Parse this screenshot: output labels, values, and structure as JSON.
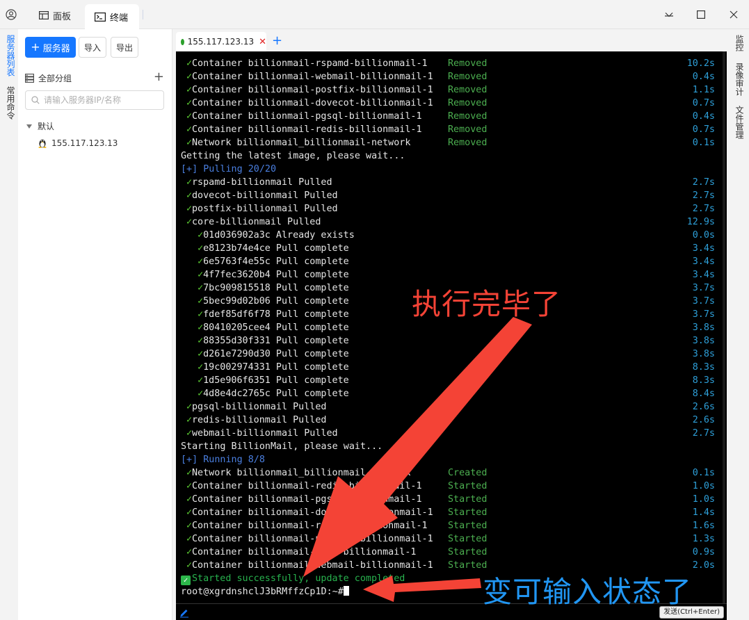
{
  "titlebar": {
    "tabs": [
      {
        "label": "面板",
        "icon": "dashboard-icon"
      },
      {
        "label": "终端",
        "icon": "terminal-icon"
      }
    ]
  },
  "left_rail": {
    "items": [
      {
        "label": "服务器列表",
        "active": true
      },
      {
        "label": "常用命令",
        "active": false
      }
    ]
  },
  "server_panel": {
    "add_label": "服务器",
    "import_label": "导入",
    "export_label": "导出",
    "group_label": "全部分组",
    "search_placeholder": "请输入服务器IP/名称",
    "default_group": "默认",
    "server_ip": "155.117.123.13"
  },
  "terminal_tab": {
    "label": "155.117.123.13"
  },
  "terminal": {
    "lines": [
      {
        "check": true,
        "text": "Container billionmail-rspamd-billionmail-1",
        "status": "Removed",
        "time": "10.2s"
      },
      {
        "check": true,
        "text": "Container billionmail-webmail-billionmail-1",
        "status": "Removed",
        "time": "0.4s"
      },
      {
        "check": true,
        "text": "Container billionmail-postfix-billionmail-1",
        "status": "Removed",
        "time": "1.1s"
      },
      {
        "check": true,
        "text": "Container billionmail-dovecot-billionmail-1",
        "status": "Removed",
        "time": "0.7s"
      },
      {
        "check": true,
        "text": "Container billionmail-pgsql-billionmail-1",
        "status": "Removed",
        "time": "0.4s"
      },
      {
        "check": true,
        "text": "Container billionmail-redis-billionmail-1",
        "status": "Removed",
        "time": "0.7s"
      },
      {
        "check": true,
        "text": "Network billionmail_billionmail-network",
        "status": "Removed",
        "time": "0.1s"
      },
      {
        "check": false,
        "text": "Getting the latest image, please wait..."
      },
      {
        "check": false,
        "text": "[+] Pulling 20/20",
        "header": true
      },
      {
        "check": true,
        "text": "rspamd-billionmail Pulled",
        "time": "2.7s"
      },
      {
        "check": true,
        "text": "dovecot-billionmail Pulled",
        "time": "2.7s"
      },
      {
        "check": true,
        "text": "postfix-billionmail Pulled",
        "time": "2.7s"
      },
      {
        "check": true,
        "text": "core-billionmail Pulled",
        "time": "12.9s"
      },
      {
        "check": true,
        "indent": true,
        "text": "01d036902a3c Already exists",
        "time": "0.0s"
      },
      {
        "check": true,
        "indent": true,
        "text": "e8123b74e4ce Pull complete",
        "time": "3.4s"
      },
      {
        "check": true,
        "indent": true,
        "text": "6e5763f4e55c Pull complete",
        "time": "3.4s"
      },
      {
        "check": true,
        "indent": true,
        "text": "4f7fec3620b4 Pull complete",
        "time": "3.4s"
      },
      {
        "check": true,
        "indent": true,
        "text": "7bc909815518 Pull complete",
        "time": "3.7s"
      },
      {
        "check": true,
        "indent": true,
        "text": "5bec99d02b06 Pull complete",
        "time": "3.7s"
      },
      {
        "check": true,
        "indent": true,
        "text": "fdef85df6f78 Pull complete",
        "time": "3.7s"
      },
      {
        "check": true,
        "indent": true,
        "text": "80410205cee4 Pull complete",
        "time": "3.8s"
      },
      {
        "check": true,
        "indent": true,
        "text": "88355d30f331 Pull complete",
        "time": "3.8s"
      },
      {
        "check": true,
        "indent": true,
        "text": "d261e7290d30 Pull complete",
        "time": "3.8s"
      },
      {
        "check": true,
        "indent": true,
        "text": "19c002974331 Pull complete",
        "time": "8.3s"
      },
      {
        "check": true,
        "indent": true,
        "text": "1d5e906f6351 Pull complete",
        "time": "8.3s"
      },
      {
        "check": true,
        "indent": true,
        "text": "4d8e4dc2765c Pull complete",
        "time": "8.4s"
      },
      {
        "check": true,
        "text": "pgsql-billionmail Pulled",
        "time": "2.6s"
      },
      {
        "check": true,
        "text": "redis-billionmail Pulled",
        "time": "2.6s"
      },
      {
        "check": true,
        "text": "webmail-billionmail Pulled",
        "time": "2.7s"
      },
      {
        "check": false,
        "text": "Starting BillionMail, please wait..."
      },
      {
        "check": false,
        "text": "[+] Running 8/8",
        "header": true
      },
      {
        "check": true,
        "text": "Network billionmail_billionmail-network",
        "status": "Created",
        "time": "0.1s"
      },
      {
        "check": true,
        "text": "Container billionmail-redis-billionmail-1",
        "status": "Started",
        "time": "1.0s"
      },
      {
        "check": true,
        "text": "Container billionmail-pgsql-billionmail-1",
        "status": "Started",
        "time": "1.0s"
      },
      {
        "check": true,
        "text": "Container billionmail-dovecot-billionmail-1",
        "status": "Started",
        "time": "1.4s"
      },
      {
        "check": true,
        "text": "Container billionmail-rspamd-billionmail-1",
        "status": "Started",
        "time": "1.6s"
      },
      {
        "check": true,
        "text": "Container billionmail-postfix-billionmail-1",
        "status": "Started",
        "time": "1.3s"
      },
      {
        "check": true,
        "text": "Container billionmail-core-billionmail-1",
        "status": "Started",
        "time": "0.9s"
      },
      {
        "check": true,
        "text": "Container billionmail-webmail-billionmail-1",
        "status": "Started",
        "time": "2.0s"
      },
      {
        "check": false,
        "success_box": true,
        "text": "Started successfully, update completed",
        "final": true
      },
      {
        "check": false,
        "text": "root@xgrdnshclJ3bRMffzCp1D:~#",
        "prompt": true
      }
    ]
  },
  "send_bar": {
    "send_label": "发送(Ctrl+Enter)"
  },
  "right_rail": {
    "items": [
      {
        "label": "监控"
      },
      {
        "label": "录像审计"
      },
      {
        "label": "文件管理"
      }
    ]
  },
  "annotations": {
    "top": "执行完毕了",
    "bottom": "变可输入状态了",
    "top_color": "#f44336",
    "bottom_color": "#2196f3",
    "arrow_color": "#f44336"
  },
  "colors": {
    "accent": "#1677ff",
    "check": "#5ccc33",
    "status": "#4caf50",
    "time": "#2e9fd8",
    "header": "#4a7fe0"
  }
}
